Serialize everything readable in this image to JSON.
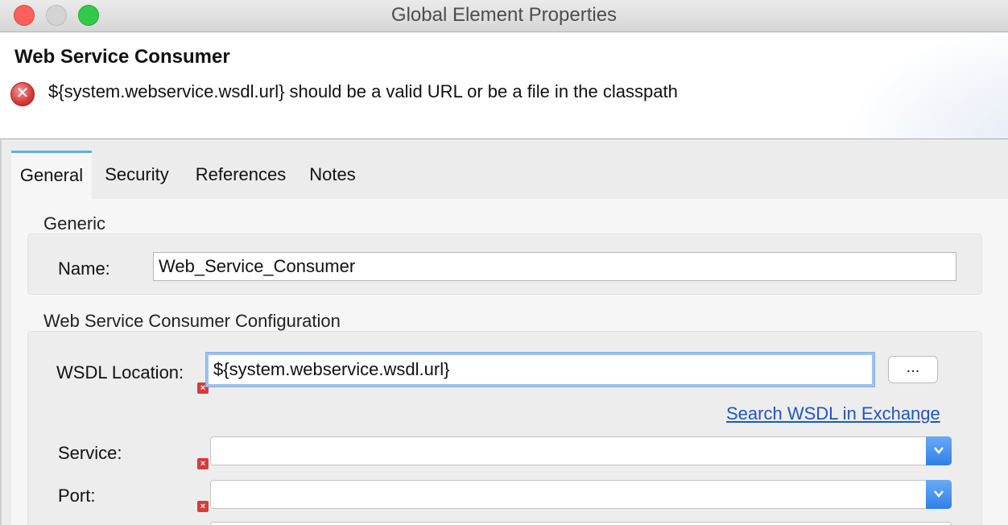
{
  "window": {
    "title": "Global Element Properties"
  },
  "header": {
    "title": "Web Service Consumer",
    "error_message": "${system.webservice.wsdl.url} should be a valid URL or be a file in the classpath"
  },
  "tabs": [
    {
      "label": "General",
      "active": true
    },
    {
      "label": "Security",
      "active": false
    },
    {
      "label": "References",
      "active": false
    },
    {
      "label": "Notes",
      "active": false
    }
  ],
  "generic": {
    "section_label": "Generic",
    "name_label": "Name:",
    "name_value": "Web_Service_Consumer"
  },
  "config": {
    "section_label": "Web Service Consumer Configuration",
    "wsdl_label": "WSDL Location:",
    "wsdl_value": "${system.webservice.wsdl.url}",
    "browse_label": "...",
    "search_link": "Search WSDL in Exchange",
    "service_label": "Service:",
    "service_value": "",
    "port_label": "Port:",
    "port_value": ""
  },
  "icons": {
    "error": "error-icon",
    "field_error": "error-badge-icon",
    "dropdown": "chevron-down-icon"
  },
  "colors": {
    "accent": "#5ab1e6",
    "link": "#1f55c4",
    "error": "#d93a3a",
    "select_button": "#2f7fe8"
  }
}
